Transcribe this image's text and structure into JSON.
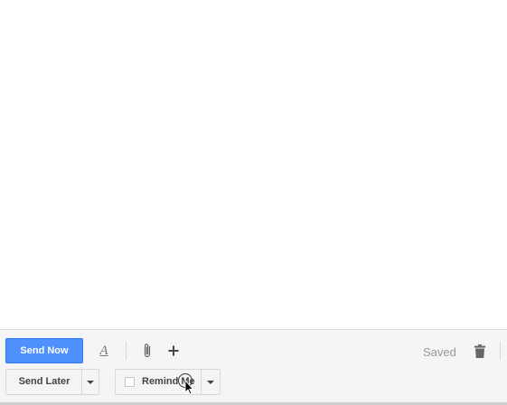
{
  "toolbar": {
    "send_now_label": "Send Now",
    "format_icon_glyph": "A",
    "saved_status": "Saved",
    "send_later_label": "Send Later",
    "remind_me_label": "Remind Me",
    "remind_me_checked": false,
    "colors": {
      "primary": "#4d90fe",
      "toolbar_bg": "#f5f5f5"
    },
    "icons": [
      "format-text-icon",
      "paperclip-icon",
      "plus-icon",
      "trash-icon",
      "chevron-down-icon",
      "pointer-cursor-icon"
    ]
  }
}
